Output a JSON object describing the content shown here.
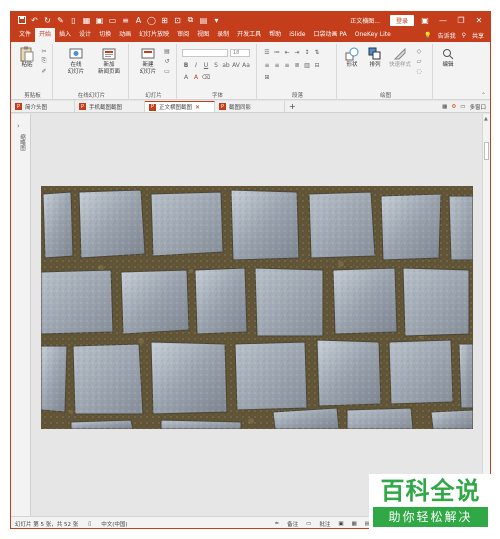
{
  "titlebar": {
    "doc_title": "正文横图...",
    "login_label": "登录",
    "minimize": "—",
    "restore": "❐",
    "close": "✕"
  },
  "tabs": [
    {
      "label": "文件",
      "active": false
    },
    {
      "label": "开始",
      "active": true
    },
    {
      "label": "插入",
      "active": false
    },
    {
      "label": "设计",
      "active": false
    },
    {
      "label": "切换",
      "active": false
    },
    {
      "label": "动画",
      "active": false
    },
    {
      "label": "幻灯片放映",
      "active": false
    },
    {
      "label": "审阅",
      "active": false
    },
    {
      "label": "视图",
      "active": false
    },
    {
      "label": "录制",
      "active": false
    },
    {
      "label": "开发工具",
      "active": false
    },
    {
      "label": "帮助",
      "active": false
    },
    {
      "label": "iSlide",
      "active": false
    },
    {
      "label": "口袋动画 PA",
      "active": false
    },
    {
      "label": "OneKey Lite",
      "active": false
    }
  ],
  "tabs_right": {
    "tellme": "告诉我",
    "share": "共享"
  },
  "ribbon": {
    "clipboard": {
      "paste": "粘贴",
      "group": "剪贴板"
    },
    "online_slides": {
      "online": "在线",
      "online2": "幻灯片",
      "new": "新加",
      "new2": "新闻页面",
      "group": "在线幻灯片"
    },
    "slides": {
      "new_slide": "新建",
      "new_slide2": "幻灯片",
      "group": "幻灯片"
    },
    "font": {
      "size": "18",
      "group": "字体"
    },
    "paragraph": {
      "group": "段落"
    },
    "drawing": {
      "shape": "形状",
      "arrange": "排列",
      "quick_styles": "快速样式",
      "group": "绘图"
    },
    "editing": {
      "label": "编辑"
    }
  },
  "doc_tabs": [
    {
      "label": "简介头图",
      "active": false
    },
    {
      "label": "手机截图截图",
      "active": false
    },
    {
      "label": "正文横图截图",
      "active": true
    },
    {
      "label": "截图同影",
      "active": false
    }
  ],
  "doc_tabs_right": {
    "multi_window": "多窗口"
  },
  "thumbpane": {
    "label": "缩略图"
  },
  "status": {
    "slide_count": "幻灯片 第 5 张，共 52 张",
    "language": "中文(中国)",
    "notes": "备注",
    "comments": "批注"
  },
  "watermark": {
    "top": "百科全说",
    "bottom": "助你轻松解决"
  },
  "colors": {
    "accent": "#c43e1c",
    "watermark_green": "#2fa845"
  }
}
